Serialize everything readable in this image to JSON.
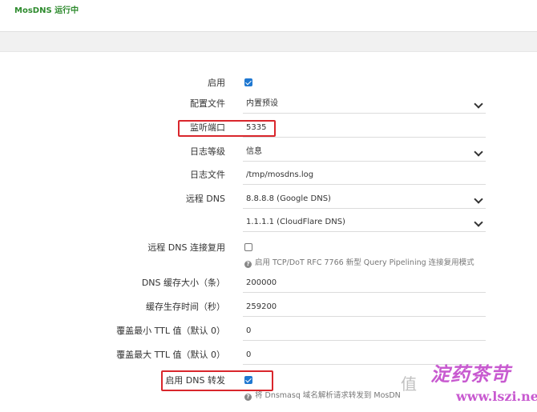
{
  "header": {
    "status": "MosDNS 运行中"
  },
  "form": {
    "enable": {
      "label": "启用",
      "checked": true
    },
    "config_file": {
      "label": "配置文件",
      "value": "内置预设"
    },
    "listen_port": {
      "label": "监听端口",
      "value": "5335"
    },
    "log_level": {
      "label": "日志等级",
      "value": "信息"
    },
    "log_file": {
      "label": "日志文件",
      "value": "/tmp/mosdns.log"
    },
    "remote_dns": {
      "label": "远程 DNS",
      "values": [
        "8.8.8.8 (Google DNS)",
        "1.1.1.1 (CloudFlare DNS)"
      ]
    },
    "remote_reuse": {
      "label": "远程 DNS 连接复用",
      "checked": false,
      "help": "启用 TCP/DoT RFC 7766 新型 Query Pipelining 连接复用模式"
    },
    "cache_size": {
      "label": "DNS 缓存大小（条）",
      "value": "200000"
    },
    "cache_ttl": {
      "label": "缓存生存时间（秒）",
      "value": "259200"
    },
    "min_ttl": {
      "label": "覆盖最小 TTL 值（默认 0）",
      "value": "0"
    },
    "max_ttl": {
      "label": "覆盖最大 TTL 值（默认 0）",
      "value": "0"
    },
    "dns_forward": {
      "label": "启用 DNS 转发",
      "checked": true,
      "help": "将 Dnsmasq 域名解析请求转发到 MosDN"
    }
  },
  "watermark": {
    "char": "值",
    "script": "淀药茶苛",
    "url": "www.lszi.net"
  },
  "colors": {
    "highlight": "#d9262c",
    "checkbox": "#1f78d1",
    "status": "#2e8b2e"
  }
}
